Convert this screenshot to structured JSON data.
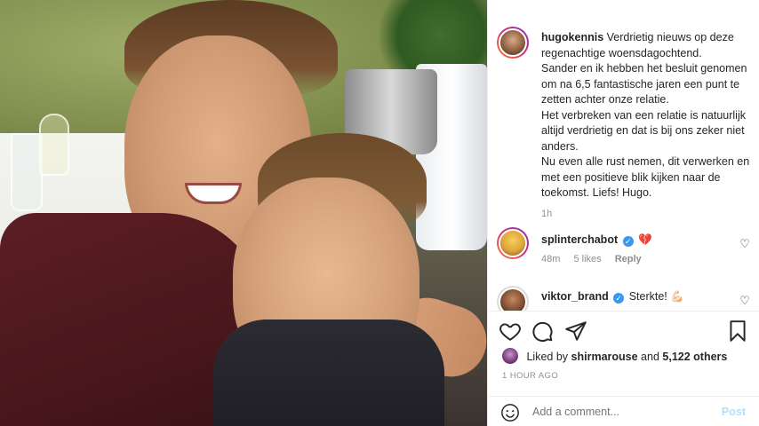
{
  "post": {
    "username": "hugokennis",
    "caption": "Verdrietig nieuws op deze regenachtige woensdagochtend.\nSander en ik hebben het besluit genomen om na 6,5 fantastische jaren een punt te zetten achter onze relatie.\nHet verbreken van een relatie is natuurlijk altijd verdrietig en dat is bij ons zeker niet anders.\nNu even alle rust nemen, dit verwerken en met een positieve blik kijken naar de toekomst. Liefs! Hugo.",
    "caption_time": "1h"
  },
  "comments": [
    {
      "username": "splinterchabot",
      "verified": true,
      "text": "💔",
      "time": "48m",
      "likes": "5 likes",
      "reply": "Reply"
    },
    {
      "username": "viktor_brand",
      "verified": true,
      "text": "Sterkte! 💪🏻"
    }
  ],
  "actions": {
    "like_icon": "heart-icon",
    "comment_icon": "comment-icon",
    "share_icon": "share-icon",
    "save_icon": "bookmark-icon"
  },
  "likes": {
    "prefix": "Liked by",
    "user": "shirmarouse",
    "and": "and",
    "count": "5,122 others"
  },
  "timestamp": "1 HOUR AGO",
  "add_comment": {
    "placeholder": "Add a comment...",
    "post_label": "Post"
  },
  "colors": {
    "link_blue": "#3897f0",
    "post_disabled": "#b2dffc",
    "text_primary": "#262626",
    "text_secondary": "#8e8e8e"
  }
}
